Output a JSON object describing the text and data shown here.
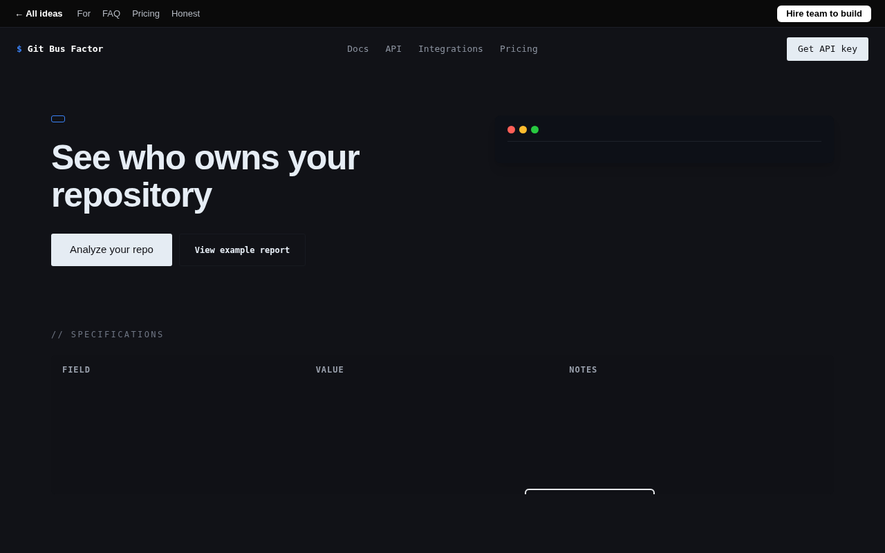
{
  "top_bar": {
    "back_link": "← All ideas",
    "links": [
      "For",
      "FAQ",
      "Pricing",
      "Honest"
    ],
    "cta": "Hire team to build"
  },
  "nav": {
    "logo_mark": "$",
    "logo_text": "Git Bus Factor",
    "links": [
      "Docs",
      "API",
      "Integrations",
      "Pricing"
    ],
    "cta": "Get API key"
  },
  "hero": {
    "headline": "See who owns your repository",
    "primary_button": "Analyze your repo",
    "secondary_button": "View example report"
  },
  "preview_window": {
    "window_dots": [
      {
        "color": "#ff5f57"
      },
      {
        "color": "#febc2e"
      },
      {
        "color": "#28c840"
      }
    ]
  },
  "specifications": {
    "heading": "// SPECIFICATIONS",
    "columns": [
      "FIELD",
      "VALUE",
      "NOTES"
    ]
  }
}
